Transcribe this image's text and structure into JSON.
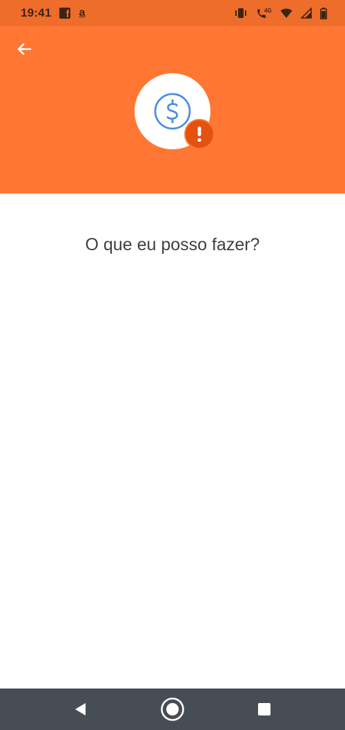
{
  "status_bar": {
    "time": "19:41",
    "left_icons": [
      "facebook-icon",
      "amazon-icon"
    ],
    "amazon_glyph": "a",
    "right_icons": [
      "vibrate-icon",
      "volte-call-icon",
      "wifi-icon",
      "cell-signal-icon",
      "battery-icon"
    ],
    "network_label": "4G"
  },
  "header": {
    "back_icon": "arrow-left-icon",
    "hero_icon": "dollar-circle-icon",
    "badge_icon": "exclamation-icon",
    "badge_glyph": "!"
  },
  "main": {
    "title": "O que eu posso fazer?"
  },
  "nav_bar": {
    "buttons": [
      "back-triangle-icon",
      "home-circle-icon",
      "recents-square-icon"
    ]
  },
  "colors": {
    "status_bar": "#ef6d2a",
    "header": "#ff7733",
    "badge": "#e5520e",
    "dollar_blue": "#4a8fe6",
    "nav_bar": "#474d54",
    "text": "#3f3f3f"
  }
}
